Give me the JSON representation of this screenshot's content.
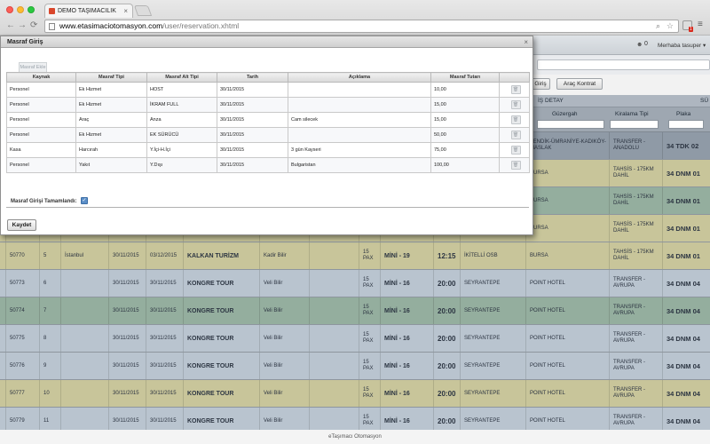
{
  "browser": {
    "tab_title": "DEMO TAŞIMACILIK",
    "tab_close": "×",
    "url_host": "www.etasimaciotomasyon.com",
    "url_path": "/user/reservation.xhtml",
    "ext_badge": "1"
  },
  "app_header": {
    "notifications": "0",
    "greeting": "Merhaba tasuper ▾"
  },
  "buttons": {
    "giris": "Giriş",
    "kontrat": "Araç Kontrat"
  },
  "table_header": {
    "group_detail": "İŞ DETAY",
    "group_last": "SÜ",
    "col_route": "Güzergah",
    "col_rent": "Kiralama Tipi",
    "col_plate": "Plaka"
  },
  "rows": [
    {
      "style": "dark",
      "id": "",
      "no": "",
      "city": "",
      "date1": "",
      "date2": "",
      "company": "",
      "driver": "",
      "empty": "",
      "pax": "",
      "vehicle": "",
      "time": "",
      "from": "",
      "to": "TENDİK-ÜMRANİYE-KADIKÖY-MASLAK",
      "type": "TRANSFER - ANADOLU",
      "plate": "34 TDK 02"
    },
    {
      "style": "tan",
      "id": "",
      "no": "",
      "city": "",
      "date1": "",
      "date2": "",
      "company": "",
      "driver": "",
      "empty": "",
      "pax": "",
      "vehicle": "",
      "time": "",
      "from": "",
      "to": "BURSA",
      "type": "TAHSİS - 175KM DAHİL",
      "plate": "34 DNM 01"
    },
    {
      "style": "green",
      "id": "",
      "no": "",
      "city": "",
      "date1": "",
      "date2": "",
      "company": "",
      "driver": "",
      "empty": "",
      "pax": "",
      "vehicle": "",
      "time": "",
      "from": "",
      "to": "BURSA",
      "type": "TAHSİS - 175KM DAHİL",
      "plate": "34 DNM 01"
    },
    {
      "style": "tan",
      "id": "",
      "no": "",
      "city": "",
      "date1": "",
      "date2": "",
      "company": "",
      "driver": "",
      "empty": "",
      "pax": "",
      "vehicle": "",
      "time": "",
      "from": "",
      "to": "BURSA",
      "type": "TAHSİS - 175KM DAHİL",
      "plate": "34 DNM 01"
    },
    {
      "style": "tan",
      "id": "50770",
      "no": "5",
      "city": "İstanbul",
      "date1": "30/11/2015",
      "date2": "03/12/2015",
      "company": "KALKAN TURİZM",
      "driver": "Kadir Bilir",
      "empty": "",
      "pax": "15 PAX",
      "vehicle": "MİNİ - 19",
      "time": "12:15",
      "from": "İKİTELLİ OSB",
      "to": "BURSA",
      "type": "TAHSİS - 175KM DAHİL",
      "plate": "34 DNM 01"
    },
    {
      "style": "grey",
      "id": "50773",
      "no": "6",
      "city": "",
      "date1": "30/11/2015",
      "date2": "30/11/2015",
      "company": "KONGRE TOUR",
      "driver": "Veli Bilir",
      "empty": "",
      "pax": "15 PAX",
      "vehicle": "MİNİ - 16",
      "time": "20:00",
      "from": "SEYRANTEPE",
      "to": "POINT HOTEL",
      "type": "TRANSFER - AVRUPA",
      "plate": "34 DNM 04"
    },
    {
      "style": "green",
      "id": "50774",
      "no": "7",
      "city": "",
      "date1": "30/11/2015",
      "date2": "30/11/2015",
      "company": "KONGRE TOUR",
      "driver": "Veli Bilir",
      "empty": "",
      "pax": "15 PAX",
      "vehicle": "MİNİ - 16",
      "time": "20:00",
      "from": "SEYRANTEPE",
      "to": "POINT HOTEL",
      "type": "TRANSFER - AVRUPA",
      "plate": "34 DNM 04"
    },
    {
      "style": "grey",
      "id": "50775",
      "no": "8",
      "city": "",
      "date1": "30/11/2015",
      "date2": "30/11/2015",
      "company": "KONGRE TOUR",
      "driver": "Veli Bilir",
      "empty": "",
      "pax": "15 PAX",
      "vehicle": "MİNİ - 16",
      "time": "20:00",
      "from": "SEYRANTEPE",
      "to": "POINT HOTEL",
      "type": "TRANSFER - AVRUPA",
      "plate": "34 DNM 04"
    },
    {
      "style": "grey",
      "id": "50776",
      "no": "9",
      "city": "",
      "date1": "30/11/2015",
      "date2": "30/11/2015",
      "company": "KONGRE TOUR",
      "driver": "Veli Bilir",
      "empty": "",
      "pax": "15 PAX",
      "vehicle": "MİNİ - 16",
      "time": "20:00",
      "from": "SEYRANTEPE",
      "to": "POINT HOTEL",
      "type": "TRANSFER - AVRUPA",
      "plate": "34 DNM 04"
    },
    {
      "style": "tan",
      "id": "50777",
      "no": "10",
      "city": "",
      "date1": "30/11/2015",
      "date2": "30/11/2015",
      "company": "KONGRE TOUR",
      "driver": "Veli Bilir",
      "empty": "",
      "pax": "15 PAX",
      "vehicle": "MİNİ - 16",
      "time": "20:00",
      "from": "SEYRANTEPE",
      "to": "POINT HOTEL",
      "type": "TRANSFER - AVRUPA",
      "plate": "34 DNM 04"
    },
    {
      "style": "grey",
      "id": "50779",
      "no": "11",
      "city": "",
      "date1": "30/11/2015",
      "date2": "30/11/2015",
      "company": "KONGRE TOUR",
      "driver": "Veli Bilir",
      "empty": "",
      "pax": "15 PAX",
      "vehicle": "MİNİ - 16",
      "time": "20:00",
      "from": "SEYRANTEPE",
      "to": "POINT HOTEL",
      "type": "TRANSFER - AVRUPA",
      "plate": "34 DNM 04"
    }
  ],
  "footer": "eTaşımacı Otomasyon",
  "modal": {
    "title": "Masraf Giriş",
    "close": "×",
    "add_label": "Masraf Ekle",
    "columns": [
      "Kaynak",
      "Masraf Tipi",
      "Masraf Alt Tipi",
      "Tarih",
      "Açıklama",
      "Masraf Tutarı",
      ""
    ],
    "items": [
      {
        "source": "Personel",
        "type": "Ek Hizmet",
        "subtype": "HOST",
        "date": "30/11/2015",
        "desc": "",
        "amount": "10,00"
      },
      {
        "source": "Personel",
        "type": "Ek Hizmet",
        "subtype": "İKRAM FULL",
        "date": "30/11/2015",
        "desc": "",
        "amount": "15,00"
      },
      {
        "source": "Personel",
        "type": "Araç",
        "subtype": "Anza",
        "date": "30/11/2015",
        "desc": "Cam silecek",
        "amount": "15,00"
      },
      {
        "source": "Personel",
        "type": "Ek Hizmet",
        "subtype": "EK SÜRÜCÜ",
        "date": "30/11/2015",
        "desc": "",
        "amount": "50,00"
      },
      {
        "source": "Kasa",
        "type": "Harcırah",
        "subtype": "Y.İçi-H.İçi",
        "date": "30/11/2015",
        "desc": "3 gün Kayseri",
        "amount": "75,00"
      },
      {
        "source": "Personel",
        "type": "Yakıt",
        "subtype": "Y.Dışı",
        "date": "30/11/2015",
        "desc": "Bulgaristan",
        "amount": "100,00"
      }
    ],
    "delete_glyph": "🗑",
    "complete_label": "Masraf Girişi Tamamlandı:",
    "complete_checked": "✓",
    "save_label": "Kaydet"
  },
  "icons": {
    "back": "←",
    "forward": "→",
    "reload": "⟳",
    "search": "⌕",
    "star": "☆",
    "menu": "≡",
    "user": "☻"
  }
}
